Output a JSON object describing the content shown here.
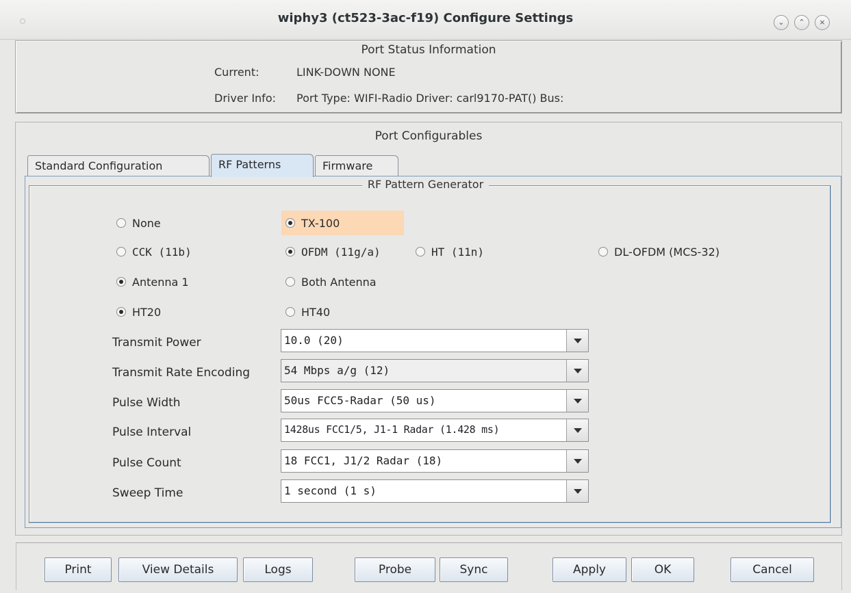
{
  "window": {
    "title": "wiphy3  (ct523-3ac-f19) Configure Settings",
    "controls": [
      "⌄",
      "⌃",
      "×"
    ]
  },
  "status": {
    "title": "Port Status Information",
    "current_label": "Current:",
    "current_value": "LINK-DOWN  NONE",
    "driver_label": "Driver Info:",
    "driver_value": "Port Type: WIFI-Radio   Driver: carl9170-PAT()  Bus:"
  },
  "configurables": {
    "title": "Port Configurables",
    "tabs": [
      "Standard Configuration",
      "RF Patterns",
      "Firmware"
    ],
    "active_tab": "RF Patterns"
  },
  "rf": {
    "title": "RF Pattern Generator",
    "radios": {
      "none": {
        "label": "None",
        "checked": false
      },
      "tx100": {
        "label": "TX-100",
        "checked": true
      },
      "cck": {
        "label": "CCK (11b)",
        "checked": false
      },
      "ofdm": {
        "label": "OFDM (11g/a)",
        "checked": true
      },
      "ht": {
        "label": "HT (11n)",
        "checked": false
      },
      "dl_ofdm": {
        "label": "DL-OFDM (MCS-32)",
        "checked": false
      },
      "antenna1": {
        "label": "Antenna 1",
        "checked": true
      },
      "both_antenna": {
        "label": "Both Antenna",
        "checked": false
      },
      "ht20": {
        "label": "HT20",
        "checked": true
      },
      "ht40": {
        "label": "HT40",
        "checked": false
      }
    },
    "fields": [
      {
        "label": "Transmit Power",
        "value": "10.0 (20)"
      },
      {
        "label": "Transmit Rate Encoding",
        "value": "54 Mbps a/g (12)"
      },
      {
        "label": "Pulse Width",
        "value": "50us FCC5-Radar (50 us)"
      },
      {
        "label": "Pulse Interval",
        "value": "1428us FCC1/5, J1-1 Radar (1.428 ms)"
      },
      {
        "label": "Pulse Count",
        "value": "18 FCC1, J1/2 Radar (18)"
      },
      {
        "label": "Sweep Time",
        "value": "1 second (1 s)"
      }
    ]
  },
  "buttons": {
    "print": "Print",
    "view_details": "View Details",
    "logs": "Logs",
    "probe": "Probe",
    "sync": "Sync",
    "apply": "Apply",
    "ok": "OK",
    "cancel": "Cancel"
  }
}
